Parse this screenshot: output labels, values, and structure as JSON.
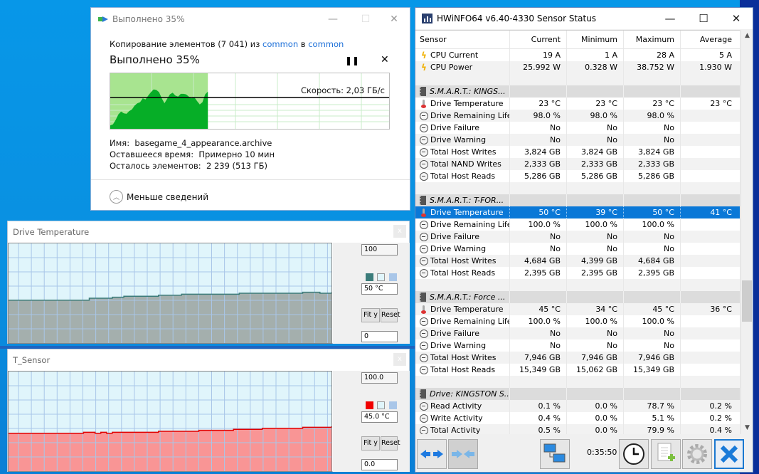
{
  "copy_dialog": {
    "title": "Выполнено 35%",
    "line_prefix": "Копирование элементов (7 041) из ",
    "source": "common",
    "mid": " в ",
    "dest": "common",
    "progress_text": "Выполнено 35%",
    "progress_percent": 35,
    "pause_icon": "pause-icon",
    "cancel_icon": "close-icon",
    "speed": "Скорость: 2,03 ГБ/с",
    "name_label": "Имя:",
    "name_value": "basegame_4_appearance.archive",
    "time_label": "Оставшееся время:",
    "time_value": "Примерно 10 мин",
    "items_label": "Осталось элементов:",
    "items_value": "2 239 (513 ГБ)",
    "less_details": "Меньше сведений",
    "speed_series": [
      0.06,
      0.08,
      0.16,
      0.26,
      0.31,
      0.28,
      0.27,
      0.32,
      0.35,
      0.42,
      0.46,
      0.48,
      0.55,
      0.53,
      0.6,
      0.66,
      0.71,
      0.7,
      0.66,
      0.55,
      0.46,
      0.54,
      0.62,
      0.65,
      0.6,
      0.58,
      0.63,
      0.63,
      0.62,
      0.58,
      0.55,
      0.57,
      0.5,
      0.44,
      0.48,
      0.62,
      0.67
    ],
    "colors": {
      "fill_done": "#a8e490",
      "speed_area": "#06ae27",
      "grid": "#c8ecc8",
      "link": "#1a6ed8"
    }
  },
  "graph_windows": [
    {
      "title": "Drive Temperature",
      "max_label": "100",
      "current_label": "50 °C",
      "min_label": "0",
      "fit_label": "Fit y",
      "reset_label": "Reset",
      "close_label": "x",
      "y_range": [
        0,
        100
      ],
      "series": [
        43,
        43,
        43,
        43,
        43,
        43,
        43,
        43,
        43,
        43,
        43,
        43,
        43,
        43,
        45,
        45,
        45,
        45,
        46,
        46,
        47,
        47,
        47,
        47,
        47,
        47,
        48,
        48,
        48,
        48,
        49,
        49,
        49,
        49,
        49,
        49,
        49,
        49,
        49,
        49,
        50,
        50,
        50,
        50,
        50,
        50,
        50,
        50,
        50,
        50,
        50,
        51,
        51,
        51,
        50,
        50,
        51
      ],
      "colors": {
        "line": "#3b7c7a",
        "fill": "#a4afad",
        "bg": "#e0f5fb",
        "grid": "#a9c6e8"
      }
    },
    {
      "title": "T_Sensor",
      "max_label": "100.0",
      "current_label": "45.0 °C",
      "min_label": "0.0",
      "fit_label": "Fit y",
      "reset_label": "Reset",
      "close_label": "x",
      "y_range": [
        0,
        100
      ],
      "series": [
        38,
        38,
        38,
        38,
        38,
        38,
        38,
        38,
        38,
        38,
        38,
        38,
        38,
        39,
        39,
        38,
        39,
        38,
        39,
        39,
        39,
        39,
        39,
        39,
        39,
        39,
        40,
        40,
        40,
        40,
        40,
        40,
        40,
        41,
        41,
        41,
        41,
        41,
        41,
        42,
        42,
        42,
        42,
        42,
        43,
        43,
        43,
        43,
        43,
        43,
        43,
        44,
        44,
        44,
        44,
        44,
        45
      ],
      "colors": {
        "line": "#e00000",
        "fill": "#f99595",
        "bg": "#e0f5fb",
        "grid": "#a9c6e8"
      }
    }
  ],
  "hwinfo": {
    "title": "HWiNFO64 v6.40-4330 Sensor Status",
    "columns": [
      "Sensor",
      "Current",
      "Minimum",
      "Maximum",
      "Average"
    ],
    "rows": [
      {
        "type": "item",
        "icon": "bolt",
        "cells": [
          "CPU Current",
          "19 A",
          "1 A",
          "28 A",
          "5 A"
        ]
      },
      {
        "type": "item",
        "icon": "bolt",
        "cells": [
          "CPU Power",
          "25.992 W",
          "0.328 W",
          "38.752 W",
          "1.930 W"
        ]
      },
      {
        "type": "blank",
        "cells": [
          "",
          "",
          "",
          "",
          ""
        ]
      },
      {
        "type": "group",
        "icon": "chip",
        "cells": [
          "S.M.A.R.T.: KINGS...",
          "",
          "",
          "",
          ""
        ]
      },
      {
        "type": "item",
        "icon": "therm",
        "cells": [
          "Drive Temperature",
          "23 °C",
          "23 °C",
          "23 °C",
          "23 °C"
        ]
      },
      {
        "type": "item",
        "icon": "clock",
        "cells": [
          "Drive Remaining Life",
          "98.0 %",
          "98.0 %",
          "98.0 %",
          ""
        ]
      },
      {
        "type": "item",
        "icon": "clock",
        "cells": [
          "Drive Failure",
          "No",
          "No",
          "No",
          ""
        ]
      },
      {
        "type": "item",
        "icon": "clock",
        "cells": [
          "Drive Warning",
          "No",
          "No",
          "No",
          ""
        ]
      },
      {
        "type": "item",
        "icon": "clock",
        "cells": [
          "Total Host Writes",
          "3,824 GB",
          "3,824 GB",
          "3,824 GB",
          ""
        ]
      },
      {
        "type": "item",
        "icon": "clock",
        "cells": [
          "Total NAND Writes",
          "2,333 GB",
          "2,333 GB",
          "2,333 GB",
          ""
        ]
      },
      {
        "type": "item",
        "icon": "clock",
        "cells": [
          "Total Host Reads",
          "5,286 GB",
          "5,286 GB",
          "5,286 GB",
          ""
        ]
      },
      {
        "type": "blank",
        "cells": [
          "",
          "",
          "",
          "",
          ""
        ]
      },
      {
        "type": "group",
        "icon": "chip",
        "cells": [
          "S.M.A.R.T.: T-FOR...",
          "",
          "",
          "",
          ""
        ]
      },
      {
        "type": "sel",
        "icon": "therm",
        "cells": [
          "Drive Temperature",
          "50 °C",
          "39 °C",
          "50 °C",
          "41 °C"
        ]
      },
      {
        "type": "item",
        "icon": "clock",
        "cells": [
          "Drive Remaining Life",
          "100.0 %",
          "100.0 %",
          "100.0 %",
          ""
        ]
      },
      {
        "type": "item",
        "icon": "clock",
        "cells": [
          "Drive Failure",
          "No",
          "No",
          "No",
          ""
        ]
      },
      {
        "type": "item",
        "icon": "clock",
        "cells": [
          "Drive Warning",
          "No",
          "No",
          "No",
          ""
        ]
      },
      {
        "type": "item",
        "icon": "clock",
        "cells": [
          "Total Host Writes",
          "4,684 GB",
          "4,399 GB",
          "4,684 GB",
          ""
        ]
      },
      {
        "type": "item",
        "icon": "clock",
        "cells": [
          "Total Host Reads",
          "2,395 GB",
          "2,395 GB",
          "2,395 GB",
          ""
        ]
      },
      {
        "type": "blank",
        "cells": [
          "",
          "",
          "",
          "",
          ""
        ]
      },
      {
        "type": "group",
        "icon": "chip",
        "cells": [
          "S.M.A.R.T.: Force ...",
          "",
          "",
          "",
          ""
        ]
      },
      {
        "type": "item",
        "icon": "therm",
        "cells": [
          "Drive Temperature",
          "45 °C",
          "34 °C",
          "45 °C",
          "36 °C"
        ]
      },
      {
        "type": "item",
        "icon": "clock",
        "cells": [
          "Drive Remaining Life",
          "100.0 %",
          "100.0 %",
          "100.0 %",
          ""
        ]
      },
      {
        "type": "item",
        "icon": "clock",
        "cells": [
          "Drive Failure",
          "No",
          "No",
          "No",
          ""
        ]
      },
      {
        "type": "item",
        "icon": "clock",
        "cells": [
          "Drive Warning",
          "No",
          "No",
          "No",
          ""
        ]
      },
      {
        "type": "item",
        "icon": "clock",
        "cells": [
          "Total Host Writes",
          "7,946 GB",
          "7,946 GB",
          "7,946 GB",
          ""
        ]
      },
      {
        "type": "item",
        "icon": "clock",
        "cells": [
          "Total Host Reads",
          "15,349 GB",
          "15,062 GB",
          "15,349 GB",
          ""
        ]
      },
      {
        "type": "blank",
        "cells": [
          "",
          "",
          "",
          "",
          ""
        ]
      },
      {
        "type": "group",
        "icon": "chip",
        "cells": [
          "Drive: KINGSTON S...",
          "",
          "",
          "",
          ""
        ]
      },
      {
        "type": "item",
        "icon": "clock",
        "cells": [
          "Read Activity",
          "0.1 %",
          "0.0 %",
          "78.7 %",
          "0.2 %"
        ]
      },
      {
        "type": "item",
        "icon": "clock",
        "cells": [
          "Write Activity",
          "0.4 %",
          "0.0 %",
          "5.1 %",
          "0.2 %"
        ]
      },
      {
        "type": "item",
        "icon": "clock",
        "cells": [
          "Total Activity",
          "0.5 %",
          "0.0 %",
          "79.9 %",
          "0.4 %"
        ]
      }
    ],
    "timer": "0:35:50",
    "footer_icons": [
      "expand-arrows-icon",
      "collapse-arrows-icon",
      "network-computers-icon",
      "clock-icon",
      "add-report-icon",
      "settings-gear-icon",
      "close-x-icon"
    ]
  }
}
